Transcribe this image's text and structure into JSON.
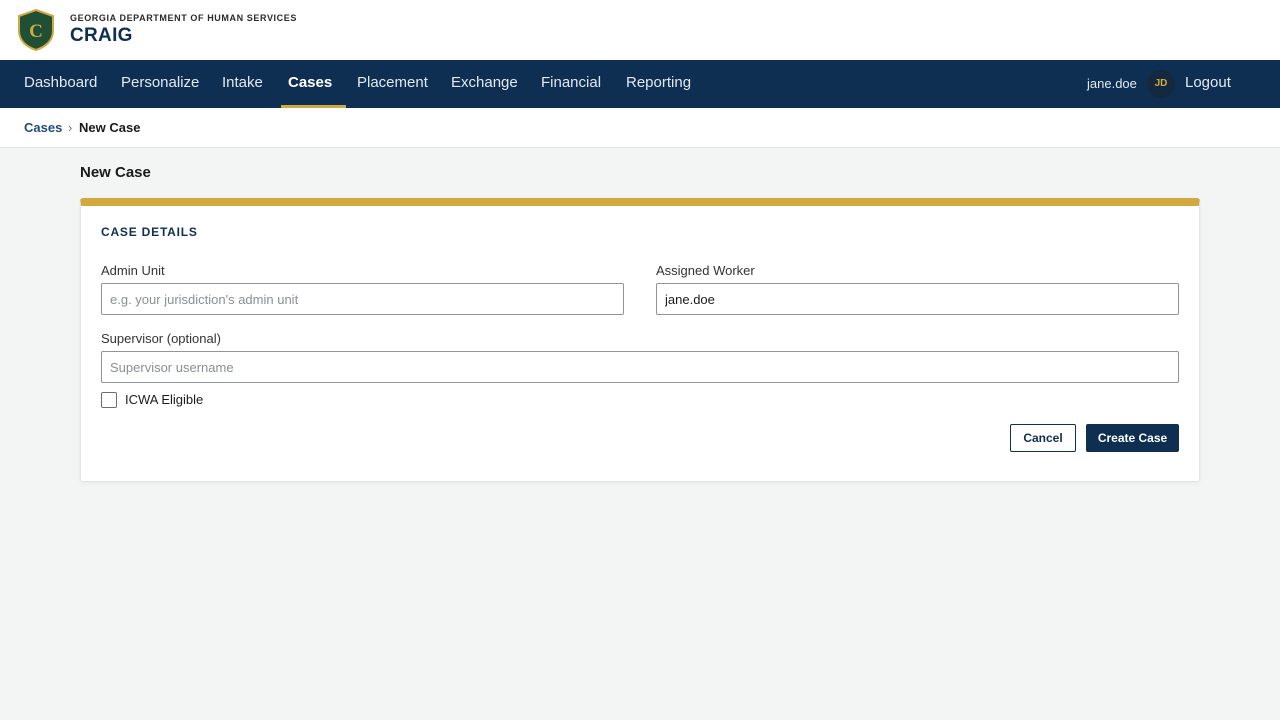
{
  "header": {
    "agency": "GEORGIA DEPARTMENT OF HUMAN SERVICES",
    "app_name": "CRAIG",
    "logo_letter": "C",
    "logo_icon": "shield-logo-icon"
  },
  "nav": {
    "items": [
      {
        "label": "Dashboard"
      },
      {
        "label": "Personalize"
      },
      {
        "label": "Intake"
      },
      {
        "label": "Cases",
        "active": true
      },
      {
        "label": "Placement"
      },
      {
        "label": "Exchange"
      },
      {
        "label": "Financial"
      },
      {
        "label": "Reporting"
      }
    ],
    "username": "jane.doe",
    "avatar_initials": "JD",
    "logout_label": "Logout"
  },
  "breadcrumb": {
    "parent": "Cases",
    "separator": "›",
    "current": "New Case"
  },
  "page": {
    "title": "New Case"
  },
  "form": {
    "section_title": "CASE DETAILS",
    "admin_unit": {
      "label": "Admin Unit",
      "placeholder": "e.g. your jurisdiction's admin unit",
      "value": ""
    },
    "assigned_worker": {
      "label": "Assigned Worker",
      "placeholder": "",
      "value": "jane.doe"
    },
    "supervisor": {
      "label": "Supervisor (optional)",
      "placeholder": "Supervisor username",
      "value": ""
    },
    "icwa": {
      "label": "ICWA Eligible",
      "checked": false
    },
    "cancel_label": "Cancel",
    "create_label": "Create Case"
  },
  "colors": {
    "navy": "#0f2f52",
    "gold": "#d2a93f",
    "logo_green": "#1f4f35",
    "background": "#f2f5f4"
  }
}
